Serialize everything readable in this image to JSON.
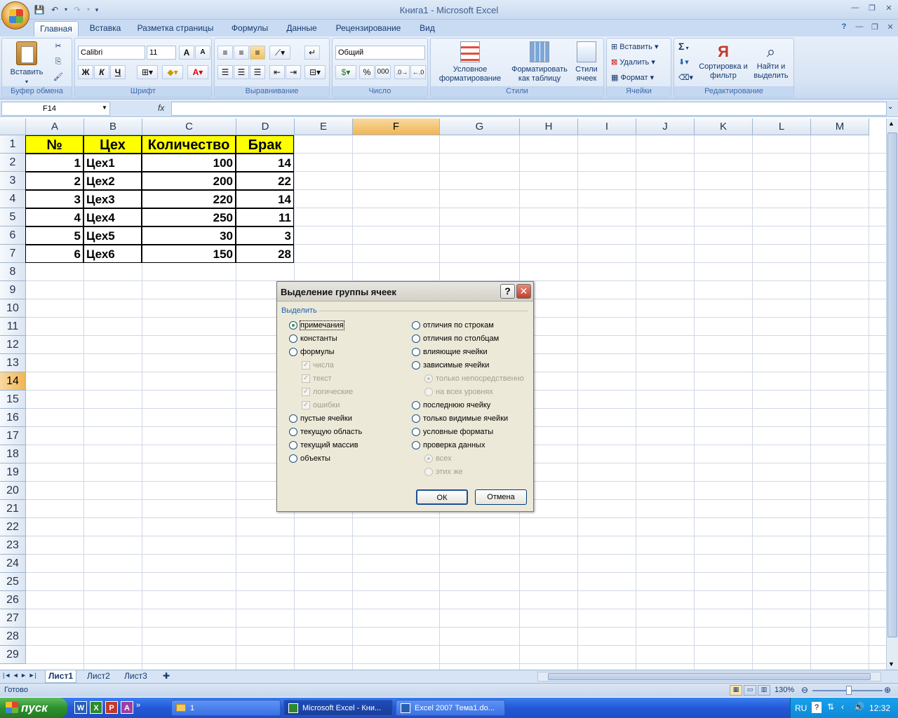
{
  "window": {
    "title": "Книга1 - Microsoft Excel"
  },
  "qat": {
    "save_icon": "save-icon",
    "undo_icon": "undo-icon",
    "redo_icon": "redo-icon"
  },
  "tabs": [
    "Главная",
    "Вставка",
    "Разметка страницы",
    "Формулы",
    "Данные",
    "Рецензирование",
    "Вид"
  ],
  "ribbon": {
    "clipboard": {
      "paste": "Вставить",
      "label": "Буфер обмена"
    },
    "font": {
      "name": "Calibri",
      "size": "11",
      "label": "Шрифт",
      "bold": "Ж",
      "italic": "К",
      "underline": "Ч"
    },
    "alignment": {
      "label": "Выравнивание"
    },
    "number": {
      "format": "Общий",
      "label": "Число",
      "percent": "%",
      "thousands": "000"
    },
    "styles": {
      "cond": "Условное форматирование",
      "table": "Форматировать как таблицу",
      "cell": "Стили ячеек",
      "label": "Стили"
    },
    "cells": {
      "insert": "Вставить",
      "delete": "Удалить",
      "format": "Формат",
      "label": "Ячейки"
    },
    "editing": {
      "sort": "Сортировка и фильтр",
      "find": "Найти и выделить",
      "label": "Редактирование",
      "sigma": "Σ"
    }
  },
  "formula_bar": {
    "name_box": "F14",
    "fx": "fx",
    "value": ""
  },
  "grid": {
    "columns": [
      "A",
      "B",
      "C",
      "D",
      "E",
      "F",
      "G",
      "H",
      "I",
      "J",
      "K",
      "L",
      "M"
    ],
    "selected_col": "F",
    "selected_row": "14",
    "rows": [
      "1",
      "2",
      "3",
      "4",
      "5",
      "6",
      "7",
      "8",
      "9",
      "10",
      "11",
      "12",
      "13",
      "14",
      "15",
      "16",
      "17",
      "18",
      "19",
      "20",
      "21",
      "22",
      "23",
      "24",
      "25",
      "26",
      "27",
      "28",
      "29"
    ],
    "header": [
      "№",
      "Цех",
      "Количество",
      "Брак"
    ],
    "data": [
      [
        "1",
        "Цех1",
        "100",
        "14"
      ],
      [
        "2",
        "Цех2",
        "200",
        "22"
      ],
      [
        "3",
        "Цех3",
        "220",
        "14"
      ],
      [
        "4",
        "Цех4",
        "250",
        "11"
      ],
      [
        "5",
        "Цех5",
        "30",
        "3"
      ],
      [
        "6",
        "Цех6",
        "150",
        "28"
      ]
    ],
    "header_fill": "#ffff00"
  },
  "sheets": [
    "Лист1",
    "Лист2",
    "Лист3"
  ],
  "status": {
    "ready": "Готово",
    "zoom": "130%"
  },
  "dialog": {
    "title": "Выделение группы ячеек",
    "help": "?",
    "group_label": "Выделить",
    "left_options": [
      "примечания",
      "константы",
      "формулы",
      "числа",
      "текст",
      "логические",
      "ошибки",
      "пустые ячейки",
      "текущую область",
      "текущий массив",
      "объекты"
    ],
    "right_options": [
      "отличия по строкам",
      "отличия по столбцам",
      "влияющие ячейки",
      "зависимые ячейки",
      "только непосредственно",
      "на всех уровнях",
      "последнюю ячейку",
      "только видимые ячейки",
      "условные форматы",
      "проверка данных",
      "всех",
      "этих же"
    ],
    "ok": "ОК",
    "cancel": "Отмена"
  },
  "taskbar": {
    "start": "пуск",
    "folder": "1",
    "excel": "Microsoft Excel - Кни...",
    "word": "Excel 2007 Тема1.do...",
    "lang": "RU",
    "clock": "12:32"
  }
}
